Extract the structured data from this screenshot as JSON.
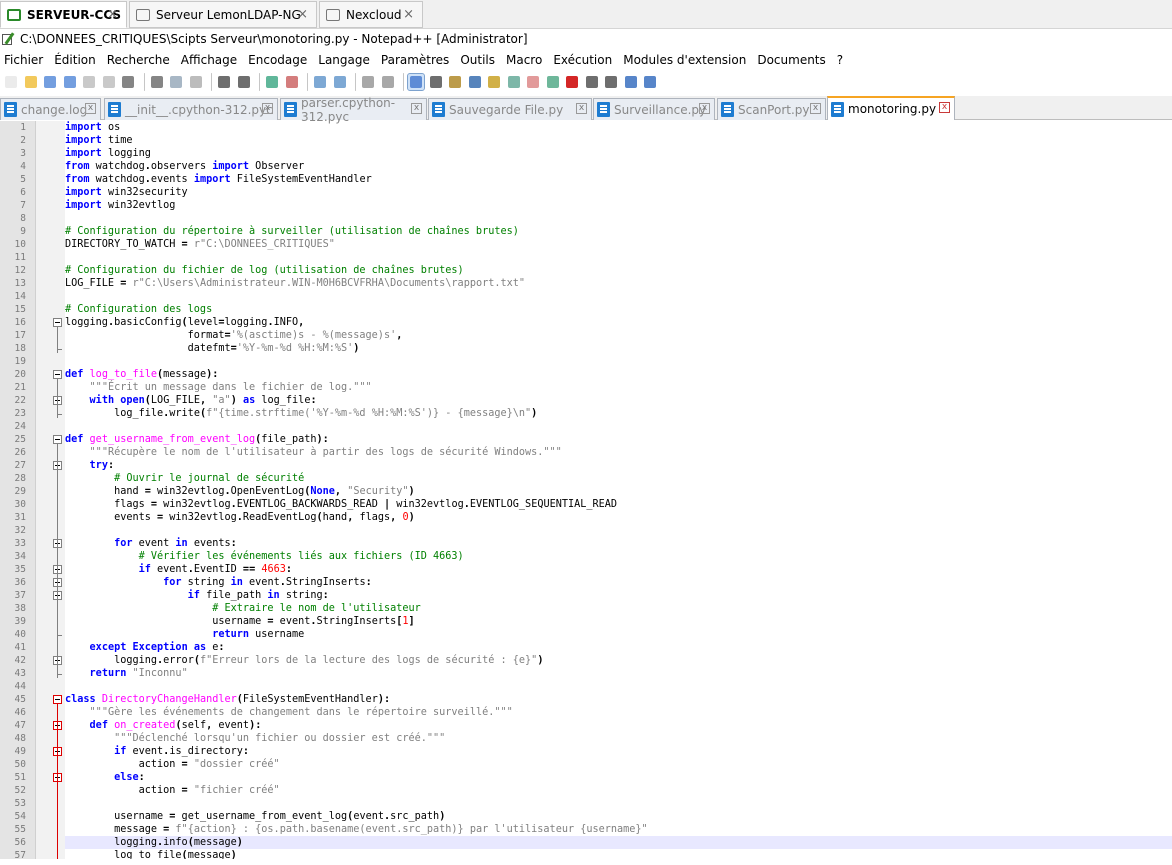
{
  "rdp_tabs": [
    {
      "label": "SERVEUR-CCS",
      "active": true
    },
    {
      "label": "Serveur LemonLDAP-NG",
      "active": false
    },
    {
      "label": "Nexcloud",
      "active": false
    }
  ],
  "window_title": "C:\\DONNEES_CRITIQUES\\Scipts Serveur\\monotoring.py - Notepad++ [Administrator]",
  "menu": [
    "Fichier",
    "Édition",
    "Recherche",
    "Affichage",
    "Encodage",
    "Langage",
    "Paramètres",
    "Outils",
    "Macro",
    "Exécution",
    "Modules d'extension",
    "Documents",
    "?"
  ],
  "toolbar_icons": [
    "new-file-icon",
    "open-file-icon",
    "save-icon",
    "save-all-icon",
    "close-icon",
    "close-all-icon",
    "print-icon",
    "cut-icon",
    "copy-icon",
    "paste-icon",
    "undo-icon",
    "redo-icon",
    "find-icon",
    "replace-icon",
    "zoom-in-icon",
    "zoom-out-icon",
    "sync-vertical-icon",
    "sync-horizontal-icon",
    "word-wrap-icon",
    "show-all-chars-icon",
    "indent-guide-icon",
    "user-defined-language-icon",
    "document-map-icon",
    "function-list-icon",
    "folder-as-workspace-icon",
    "monitoring-icon",
    "record-macro-icon",
    "stop-record-icon",
    "playback-macro-icon",
    "run-macro-multiple-icon",
    "save-macro-icon"
  ],
  "file_tabs": [
    {
      "label": "change.log",
      "active": false
    },
    {
      "label": "__init__.cpython-312.pyc",
      "active": false
    },
    {
      "label": "parser.cpython-312.pyc",
      "active": false
    },
    {
      "label": "Sauvegarde File.py",
      "active": false
    },
    {
      "label": "Surveillance.py",
      "active": false
    },
    {
      "label": "ScanPort.py",
      "active": false
    },
    {
      "label": "monotoring.py",
      "active": true
    }
  ],
  "current_line": 56,
  "code_lines": [
    "import os",
    "import time",
    "import logging",
    "from watchdog.observers import Observer",
    "from watchdog.events import FileSystemEventHandler",
    "import win32security",
    "import win32evtlog",
    "",
    "# Configuration du répertoire à surveiller (utilisation de chaînes brutes)",
    "DIRECTORY_TO_WATCH = r\"C:\\DONNEES_CRITIQUES\"",
    "",
    "# Configuration du fichier de log (utilisation de chaînes brutes)",
    "LOG_FILE = r\"C:\\Users\\Administrateur.WIN-M0H6BCVFRHA\\Documents\\rapport.txt\"",
    "",
    "# Configuration des logs",
    "logging.basicConfig(level=logging.INFO,",
    "                    format='%(asctime)s - %(message)s',",
    "                    datefmt='%Y-%m-%d %H:%M:%S')",
    "",
    "def log_to_file(message):",
    "    \"\"\"Écrit un message dans le fichier de log.\"\"\"",
    "    with open(LOG_FILE, \"a\") as log_file:",
    "        log_file.write(f\"{time.strftime('%Y-%m-%d %H:%M:%S')} - {message}\\n\")",
    "",
    "def get_username_from_event_log(file_path):",
    "    \"\"\"Récupère le nom de l'utilisateur à partir des logs de sécurité Windows.\"\"\"",
    "    try:",
    "        # Ouvrir le journal de sécurité",
    "        hand = win32evtlog.OpenEventLog(None, \"Security\")",
    "        flags = win32evtlog.EVENTLOG_BACKWARDS_READ | win32evtlog.EVENTLOG_SEQUENTIAL_READ",
    "        events = win32evtlog.ReadEventLog(hand, flags, 0)",
    "",
    "        for event in events:",
    "            # Vérifier les événements liés aux fichiers (ID 4663)",
    "            if event.EventID == 4663:",
    "                for string in event.StringInserts:",
    "                    if file_path in string:",
    "                        # Extraire le nom de l'utilisateur",
    "                        username = event.StringInserts[1]",
    "                        return username",
    "    except Exception as e:",
    "        logging.error(f\"Erreur lors de la lecture des logs de sécurité : {e}\")",
    "    return \"Inconnu\"",
    "",
    "class DirectoryChangeHandler(FileSystemEventHandler):",
    "    \"\"\"Gère les événements de changement dans le répertoire surveillé.\"\"\"",
    "    def on_created(self, event):",
    "        \"\"\"Déclenché lorsqu'un fichier ou dossier est créé.\"\"\"",
    "        if event.is_directory:",
    "            action = \"dossier créé\"",
    "        else:",
    "            action = \"fichier créé\"",
    "",
    "        username = get_username_from_event_log(event.src_path)",
    "        message = f\"{action} : {os.path.basename(event.src_path)} par l'utilisateur {username}\"",
    "        logging.info(message)",
    "        log_to_file(message)"
  ],
  "colors": {
    "keyword": "#0000ff",
    "comment": "#008000",
    "string": "#808080",
    "number": "#ff0000",
    "funcname": "#ff00ff",
    "current_line": "#e8e8ff",
    "tab_accent": "#f6a423"
  }
}
